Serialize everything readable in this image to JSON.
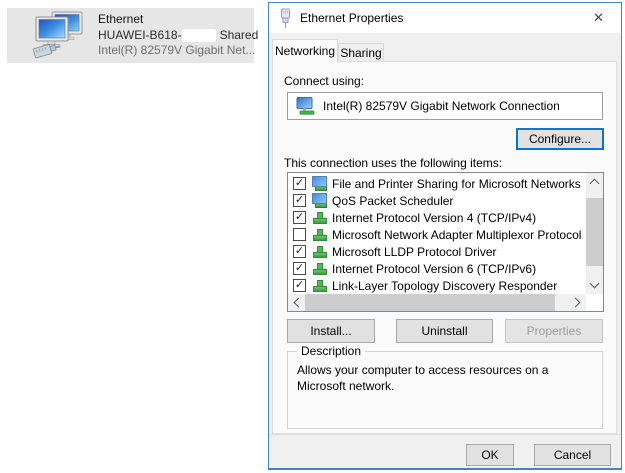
{
  "background_item": {
    "title": "Ethernet",
    "network_prefix": "HUAWEI-B618-",
    "shared_label": "Shared",
    "adapter_short": "Intel(R) 82579V Gigabit Net...",
    "icon": "ethernet-connection-icon"
  },
  "dialog": {
    "title": "Ethernet Properties",
    "titlebar_icon": "ethernet-plug-icon",
    "close_glyph": "✕",
    "tabs": [
      {
        "label": "Networking",
        "active": true
      },
      {
        "label": "Sharing",
        "active": false
      }
    ],
    "connect_using_label": "Connect using:",
    "adapter": {
      "name": "Intel(R) 82579V Gigabit Network Connection",
      "icon": "network-adapter-icon"
    },
    "configure_button": "Configure...",
    "items_label": "This connection uses the following items:",
    "list": {
      "items": [
        {
          "label": "File and Printer Sharing for Microsoft Networks",
          "checked": true,
          "check": "✓",
          "icon": "service"
        },
        {
          "label": "QoS Packet Scheduler",
          "checked": true,
          "check": "✓",
          "icon": "service"
        },
        {
          "label": "Internet Protocol Version 4 (TCP/IPv4)",
          "checked": true,
          "check": "✓",
          "icon": "protocol"
        },
        {
          "label": "Microsoft Network Adapter Multiplexor Protocol",
          "checked": false,
          "check": "",
          "icon": "protocol"
        },
        {
          "label": "Microsoft LLDP Protocol Driver",
          "checked": true,
          "check": "✓",
          "icon": "protocol"
        },
        {
          "label": "Internet Protocol Version 6 (TCP/IPv6)",
          "checked": true,
          "check": "✓",
          "icon": "protocol"
        },
        {
          "label": "Link-Layer Topology Discovery Responder",
          "checked": true,
          "check": "✓",
          "icon": "protocol"
        }
      ]
    },
    "buttons": {
      "install": "Install...",
      "uninstall": "Uninstall",
      "properties": "Properties",
      "properties_enabled": false
    },
    "description": {
      "title": "Description",
      "text": "Allows your computer to access resources on a Microsoft network."
    },
    "footer": {
      "ok": "OK",
      "cancel": "Cancel"
    }
  },
  "colors": {
    "dialog_border": "#4484c4",
    "focus_border": "#0078d7",
    "selection_bg": "#e6e6e6",
    "button_bg": "#e1e1e1",
    "protocol_icon_green": "#57b75c",
    "monitor_blue": "#3f8fe0"
  }
}
